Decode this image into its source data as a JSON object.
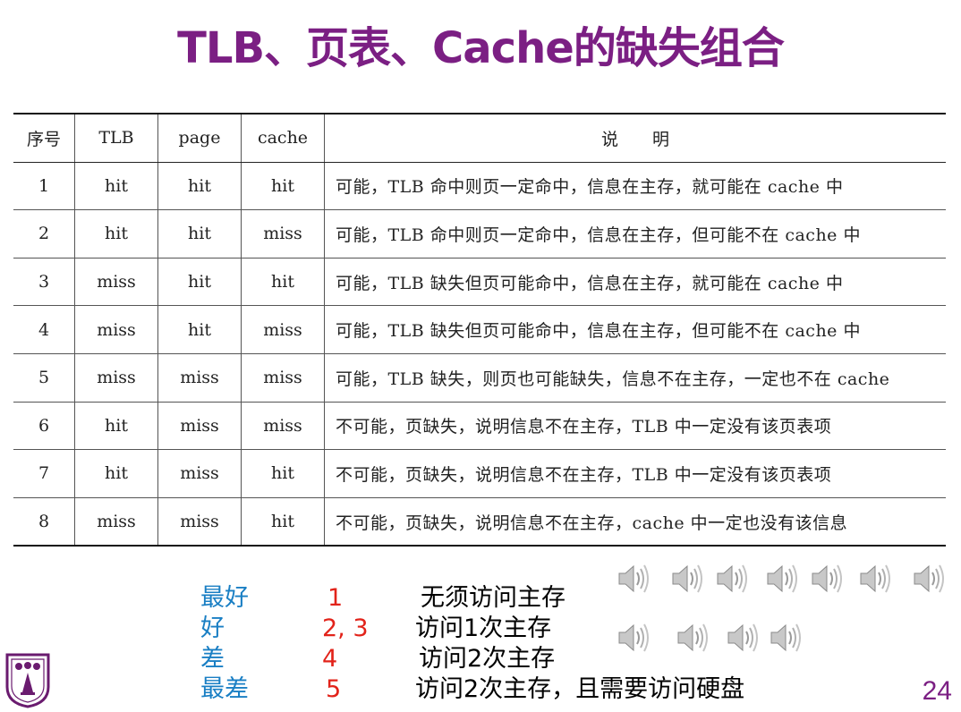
{
  "title": "TLB、页表、Cache的缺失组合",
  "table": {
    "headers": [
      "序号",
      "TLB",
      "page",
      "cache",
      "说　　明"
    ],
    "rows": [
      [
        "1",
        "hit",
        "hit",
        "hit",
        "可能，TLB 命中则页一定命中，信息在主存，就可能在 cache 中"
      ],
      [
        "2",
        "hit",
        "hit",
        "miss",
        "可能，TLB 命中则页一定命中，信息在主存，但可能不在 cache 中"
      ],
      [
        "3",
        "miss",
        "hit",
        "hit",
        "可能，TLB 缺失但页可能命中，信息在主存，就可能在 cache 中"
      ],
      [
        "4",
        "miss",
        "hit",
        "miss",
        "可能，TLB 缺失但页可能命中，信息在主存，但可能不在 cache 中"
      ],
      [
        "5",
        "miss",
        "miss",
        "miss",
        "可能，TLB 缺失，则页也可能缺失，信息不在主存，一定也不在 cache"
      ],
      [
        "6",
        "hit",
        "miss",
        "miss",
        "不可能，页缺失，说明信息不在主存，TLB 中一定没有该页表项"
      ],
      [
        "7",
        "hit",
        "miss",
        "hit",
        "不可能，页缺失，说明信息不在主存，TLB 中一定没有该页表项"
      ],
      [
        "8",
        "miss",
        "miss",
        "hit",
        "不可能，页缺失，说明信息不在主存，cache 中一定也没有该信息"
      ]
    ]
  },
  "legend": [
    {
      "level": "最好",
      "rows": "1",
      "desc": "无须访问主存"
    },
    {
      "level": "好",
      "rows": "2, 3",
      "desc": "访问1次主存"
    },
    {
      "level": "差",
      "rows": "4",
      "desc": "访问2次主存"
    },
    {
      "level": "最差",
      "rows": "5",
      "desc": "访问2次主存，且需要访问硬盘"
    }
  ],
  "icons": {
    "speaker": "speaker-icon",
    "logo": "university-seal"
  },
  "page_number": "24",
  "colors": {
    "title": "#7b1f83",
    "level": "#1a7fc4",
    "number": "#e2231a"
  }
}
